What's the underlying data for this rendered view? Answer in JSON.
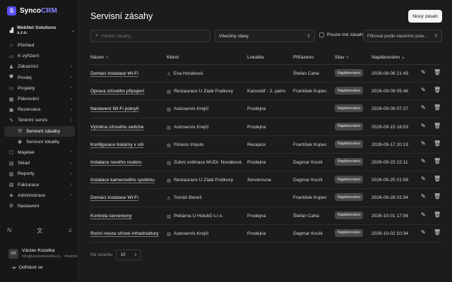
{
  "brand": {
    "logo": "S",
    "name": "Synco",
    "accent": "CRM"
  },
  "company": {
    "name": "WebNet Solutions s.r.o."
  },
  "sidebar": {
    "items": [
      {
        "label": "Přehled",
        "icon": "home-icon",
        "sub": false,
        "arrow": false,
        "active": false
      },
      {
        "label": "K vyřízení",
        "icon": "inbox-icon",
        "sub": false,
        "arrow": false,
        "active": false
      },
      {
        "label": "Zákazníci",
        "icon": "users-icon",
        "sub": false,
        "arrow": true,
        "active": false
      },
      {
        "label": "Prodej",
        "icon": "cart-icon",
        "sub": false,
        "arrow": true,
        "active": false
      },
      {
        "label": "Projekty",
        "icon": "folder-icon",
        "sub": false,
        "arrow": true,
        "active": false
      },
      {
        "label": "Plánování",
        "icon": "calendar-icon",
        "sub": false,
        "arrow": true,
        "active": false
      },
      {
        "label": "Rezervace",
        "icon": "calendar-check-icon",
        "sub": false,
        "arrow": true,
        "active": false
      },
      {
        "label": "Terénní servis",
        "icon": "wrench-icon",
        "sub": false,
        "arrow": true,
        "active": false
      },
      {
        "label": "Servisní zásahy",
        "icon": "tool-icon",
        "sub": true,
        "arrow": false,
        "active": true
      },
      {
        "label": "Servisní lokality",
        "icon": "pin-icon",
        "sub": true,
        "arrow": false,
        "active": false
      },
      {
        "label": "Majetek",
        "icon": "box-icon",
        "sub": false,
        "arrow": true,
        "active": false
      },
      {
        "label": "Sklad",
        "icon": "warehouse-icon",
        "sub": false,
        "arrow": true,
        "active": false
      },
      {
        "label": "Reporty",
        "icon": "chart-icon",
        "sub": false,
        "arrow": true,
        "active": false
      },
      {
        "label": "Fakturace",
        "icon": "invoice-icon",
        "sub": false,
        "arrow": true,
        "active": false
      },
      {
        "label": "Administrace",
        "icon": "shield-icon",
        "sub": false,
        "arrow": true,
        "active": false
      },
      {
        "label": "Nastavení",
        "icon": "gear-icon",
        "sub": false,
        "arrow": false,
        "active": false
      }
    ]
  },
  "user": {
    "initials": "VK",
    "name": "Václav Kozelka",
    "email": "info@vaclavkozelka.cz · Vlastník"
  },
  "logout_label": "Odhlásit se",
  "page": {
    "title": "Servisní zásahy",
    "new_button": "Nový zásah"
  },
  "filters": {
    "search_placeholder": "Hledat zásahy...",
    "status_value": "Všechny stavy",
    "only_mine_label": "Pouze mé zásahy",
    "location_placeholder": "Filtrovat podle vlastního pole..."
  },
  "table": {
    "columns": {
      "name": "Název",
      "client": "Klient",
      "location": "Lokalita",
      "assigned": "Přiřazeno",
      "status": "Stav",
      "planned": "Naplánováno"
    },
    "rows": [
      {
        "name": "Domácí instalace Wi-Fi",
        "client": "Eva Horáková",
        "client_type": "person",
        "location": "",
        "assigned": "Štefan Caha",
        "status": "Naplánováno",
        "planned": "2026-09-08 21:43"
      },
      {
        "name": "Oprava síťového připojení",
        "client": "Restaurace U Zlaté Podkovy",
        "client_type": "company",
        "location": "Kancelář - 2. patro",
        "assigned": "František Kupec",
        "status": "Naplánováno",
        "planned": "2026-09-09 05:46"
      },
      {
        "name": "Nastavení Wi-Fi pokrytí",
        "client": "Autoservis Krejčí",
        "client_type": "company",
        "location": "Prodejna",
        "assigned": "",
        "status": "Naplánováno",
        "planned": "2026-09-09 07:27"
      },
      {
        "name": "Výměna síťového switche",
        "client": "Autoservis Krejčí",
        "client_type": "company",
        "location": "Prodejna",
        "assigned": "",
        "status": "Naplánováno",
        "planned": "2026-09-15 18:03"
      },
      {
        "name": "Konfigurace tiskárny v síti",
        "client": "Fitness Impuls",
        "client_type": "company",
        "location": "Recepce",
        "assigned": "František Kupec",
        "status": "Naplánováno",
        "planned": "2026-09-17 20:19"
      },
      {
        "name": "Instalace nového routeru",
        "client": "Zubní ordinace MUDr. Nováková",
        "client_type": "company",
        "location": "Prodejna",
        "assigned": "Dagmar Kosík",
        "status": "Naplánováno",
        "planned": "2026-09-23 22:11"
      },
      {
        "name": "Instalace kamerového systému",
        "client": "Restaurace U Zlaté Podkovy",
        "client_type": "company",
        "location": "Serverovna",
        "assigned": "Dagmar Kosík",
        "status": "Naplánováno",
        "planned": "2026-09-25 01:58"
      },
      {
        "name": "Domácí instalace Wi-Fi",
        "client": "Tomáš Beneš",
        "client_type": "person",
        "location": "",
        "assigned": "František Kupec",
        "status": "Naplánováno",
        "planned": "2026-09-28 02:34"
      },
      {
        "name": "Kontrola serverovny",
        "client": "Pekárna U Holubů s.r.o.",
        "client_type": "company",
        "location": "Prodejna",
        "assigned": "Štefan Caha",
        "status": "Naplánováno",
        "planned": "2026-10-01 17:06"
      },
      {
        "name": "Roční revize síťové infrastruktury",
        "client": "Autoservis Krejčí",
        "client_type": "company",
        "location": "Prodejna",
        "assigned": "Dagmar Kosík",
        "status": "Naplánováno",
        "planned": "2026-10-02 10:34"
      }
    ]
  },
  "pager": {
    "label": "Na stránku",
    "value": "10"
  }
}
